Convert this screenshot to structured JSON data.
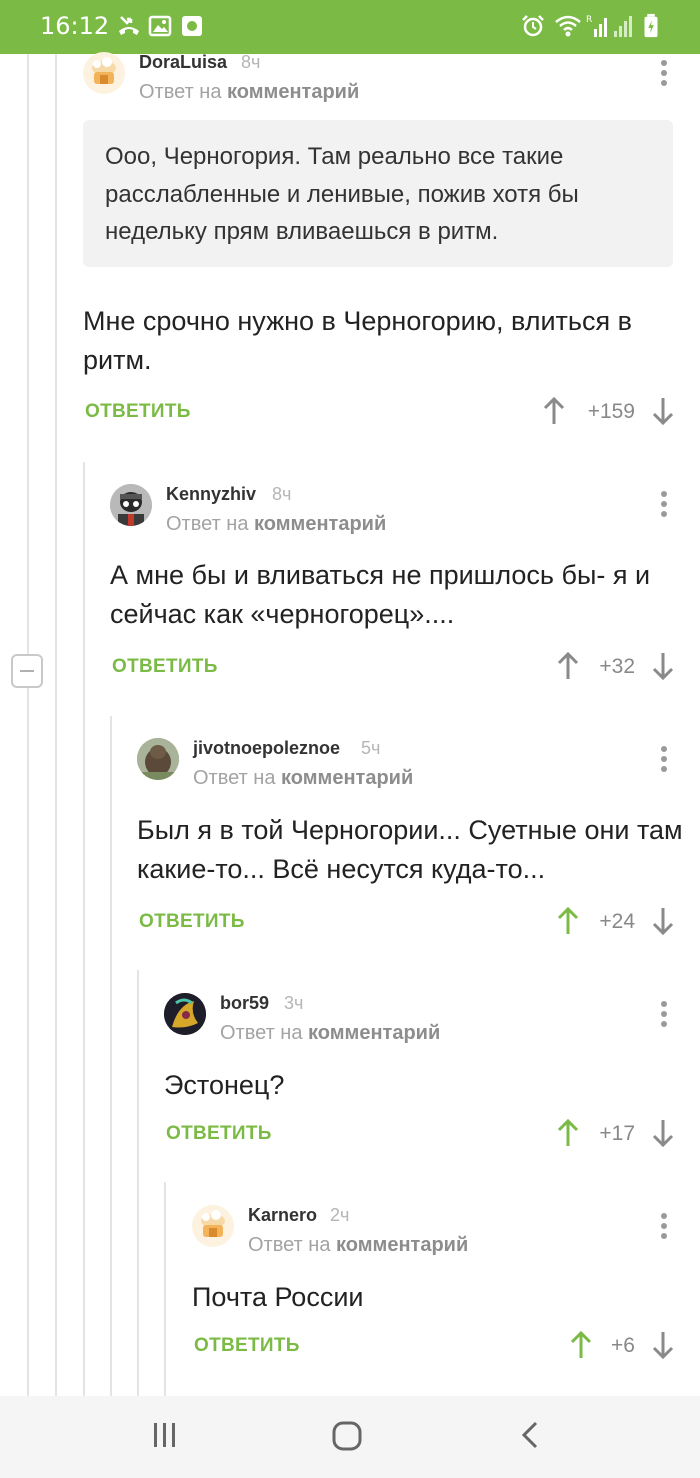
{
  "status_bar": {
    "time": "16:12",
    "left_icons": [
      "missed-call-icon",
      "gallery-icon",
      "app-icon"
    ],
    "right_icons": [
      "alarm-icon",
      "wifi-icon",
      "signal-icon",
      "signal-icon-2",
      "battery-icon"
    ],
    "bg_color": "#7bbb45"
  },
  "accent_color": "#7bbb45",
  "comments": [
    {
      "author": "DoraLuisa",
      "time": "8ч",
      "reply_prefix": "Ответ на",
      "reply_link": "комментарий",
      "quote": "Ооо, Черногория. Там реально все такие расслабленные и ленивые, пожив хотя бы недельку прям вливаешься в ритм.",
      "text": "Мне срочно нужно в Черногорию, влиться в ритм.",
      "reply_label": "ОТВЕТИТЬ",
      "score": "+159",
      "upvoted": false
    },
    {
      "author": "Kennyzhiv",
      "time": "8ч",
      "reply_prefix": "Ответ на",
      "reply_link": "комментарий",
      "text": "А мне бы и вливаться не пришлось бы- я и сейчас как «черногорец»....",
      "reply_label": "ОТВЕТИТЬ",
      "score": "+32",
      "upvoted": false
    },
    {
      "author": "jivotnoepoleznoe",
      "time": "5ч",
      "reply_prefix": "Ответ на",
      "reply_link": "комментарий",
      "text": "Был я в той Черногории... Суетные они там какие-то... Всё несутся куда-то...",
      "reply_label": "ОТВЕТИТЬ",
      "score": "+24",
      "upvoted": true
    },
    {
      "author": "bor59",
      "time": "3ч",
      "reply_prefix": "Ответ на",
      "reply_link": "комментарий",
      "text": "Эстонец?",
      "reply_label": "ОТВЕТИТЬ",
      "score": "+17",
      "upvoted": true
    },
    {
      "author": "Karnero",
      "time": "2ч",
      "reply_prefix": "Ответ на",
      "reply_link": "комментарий",
      "text": "Почта России",
      "reply_label": "ОТВЕТИТЬ",
      "score": "+6",
      "upvoted": true
    }
  ],
  "nav_bar": {
    "icons": [
      "recent-apps-icon",
      "home-icon",
      "back-icon"
    ]
  }
}
